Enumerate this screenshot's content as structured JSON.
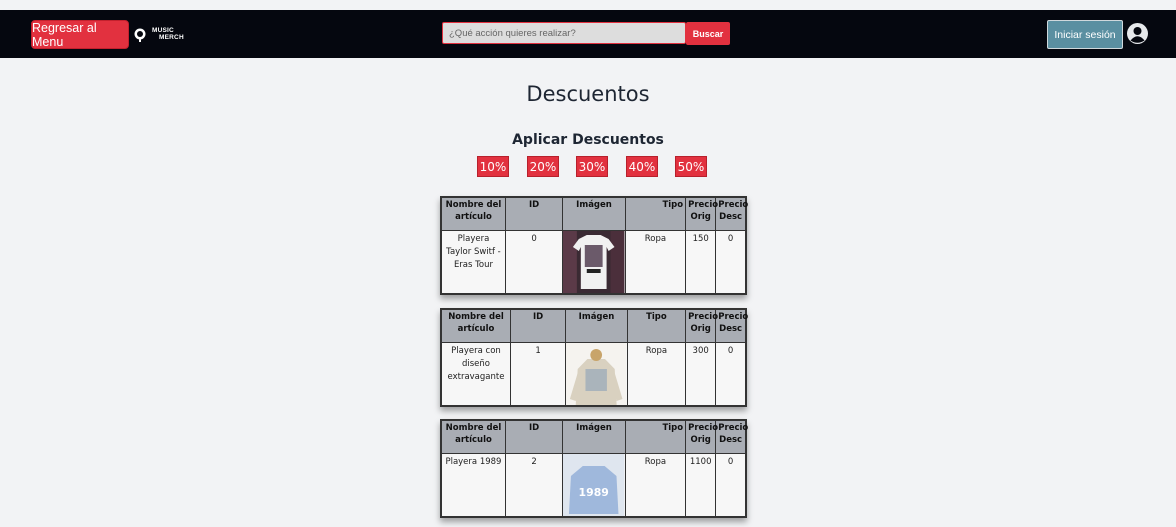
{
  "header": {
    "back_label": "Regresar al Menu",
    "logo_text_line1": "MUSIC",
    "logo_text_line2": "MERCH",
    "search_placeholder": "¿Qué acción quieres realizar?",
    "search_button": "Buscar",
    "login_label": "Iniciar sesión",
    "colors": {
      "bar": "#05070f",
      "accent": "#e2313f",
      "login": "#5a8fa1"
    }
  },
  "page_title": "Descuentos",
  "discounts": {
    "title": "Aplicar Descuentos",
    "options": [
      "10%",
      "20%",
      "30%",
      "40%",
      "50%"
    ]
  },
  "table_headers": {
    "name": "Nombre del artículo",
    "id": "ID",
    "image": "Imágen",
    "type": "Tipo",
    "price_orig": "Precio Orig",
    "price_desc": "Precio Desc"
  },
  "products": [
    {
      "name": "Playera Taylor Switf - Eras Tour",
      "id": "0",
      "image_icon": "tshirt-photo-icon",
      "type": "Ropa",
      "price_orig": "150",
      "price_desc": "0"
    },
    {
      "name": "Playera con diseño extravagante",
      "id": "1",
      "image_icon": "sweatshirt-photo-icon",
      "type": "Ropa",
      "price_orig": "300",
      "price_desc": "0"
    },
    {
      "name": "Playera 1989",
      "id": "2",
      "image_icon": "sweatshirt-1989-photo-icon",
      "type": "Ropa",
      "price_orig": "1100",
      "price_desc": "0"
    }
  ],
  "image_text_1989": "1989"
}
